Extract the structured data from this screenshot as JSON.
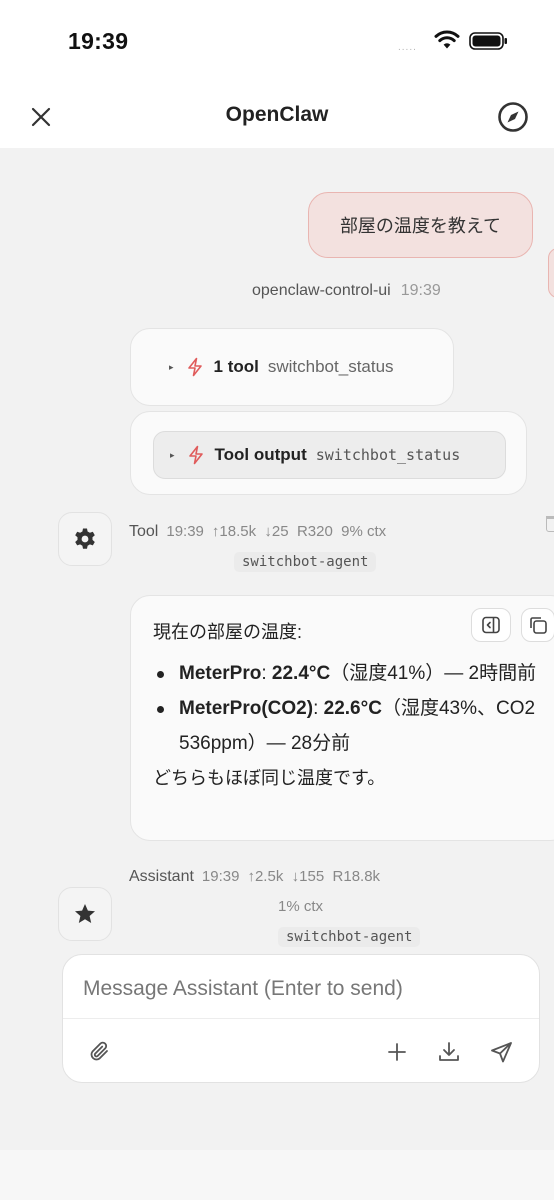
{
  "status_bar": {
    "time": "19:39",
    "signal": "....."
  },
  "header": {
    "title": "OpenClaw"
  },
  "user_message": {
    "text": "部屋の温度を教えて",
    "sender": "openclaw-control-ui",
    "time": "19:39"
  },
  "tool_call": {
    "label": "1 tool",
    "name": "switchbot_status"
  },
  "tool_output": {
    "label": "Tool output",
    "name": "switchbot_status"
  },
  "tool_meta": {
    "role": "Tool",
    "time": "19:39",
    "stats": "↑18.5k  ↓25  R320  9% ctx",
    "agent": "switchbot-agent"
  },
  "reply": {
    "heading": "現在の部屋の温度:",
    "items": [
      {
        "device": "MeterPro",
        "sep": ": ",
        "temp": "22.4°C",
        "rest": "（湿度41%）— 2時間前"
      },
      {
        "device": "MeterPro(CO2)",
        "sep": ": ",
        "temp": "22.6°C",
        "rest": "（湿度43%、CO2 536ppm）— 28分前"
      }
    ],
    "closing": "どちらもほぼ同じ温度です。"
  },
  "assistant_meta": {
    "role": "Assistant",
    "time": "19:39",
    "stats": "↑2.5k  ↓155  R18.8k",
    "ctx": "1% ctx",
    "agent": "switchbot-agent"
  },
  "composer": {
    "placeholder": "Message Assistant (Enter to send)"
  },
  "icons": {
    "close": "close-icon",
    "compass": "compass-icon",
    "gear": "gear-icon",
    "star": "star-icon",
    "attach": "paperclip-icon",
    "add": "plus-icon",
    "download": "download-icon",
    "send": "send-icon"
  },
  "colors": {
    "accent": "#e05c5c",
    "user_bubble": "#f3e1df",
    "user_border": "#e9b5b1"
  }
}
